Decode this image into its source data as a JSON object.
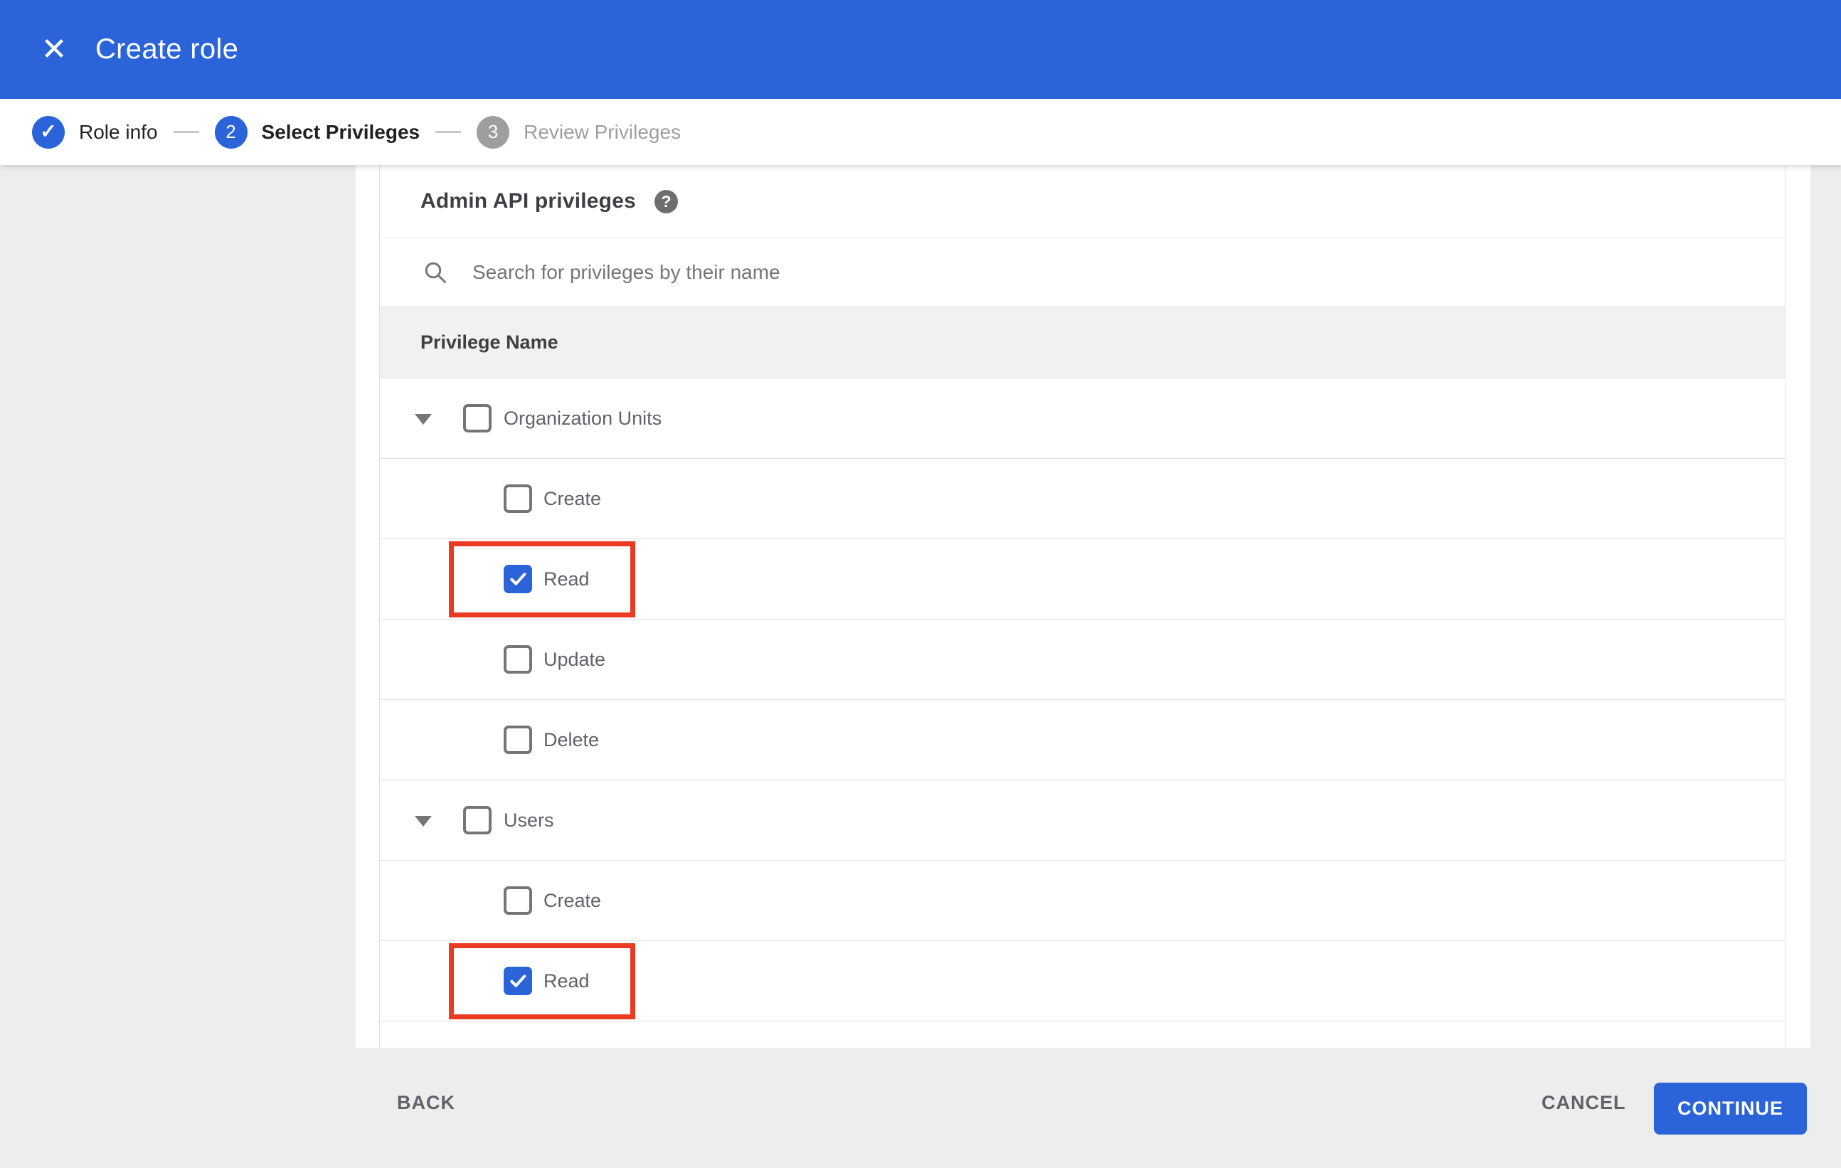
{
  "colors": {
    "accent": "#2b64d9",
    "highlight_red": "#e83b22",
    "page_gray": "#ededed",
    "step_inactive_gray": "#9e9e9e"
  },
  "icons": {
    "close": "✕",
    "check": "✓",
    "help": "?"
  },
  "titlebar": {
    "title": "Create role"
  },
  "stepper": {
    "steps": [
      {
        "label": "Role info",
        "status": "complete",
        "number": ""
      },
      {
        "label": "Select Privileges",
        "status": "current",
        "number": "2"
      },
      {
        "label": "Review Privileges",
        "status": "upcoming",
        "number": "3"
      }
    ]
  },
  "panel": {
    "heading": "Admin API privileges",
    "search": {
      "placeholder": "Search for privileges by their name",
      "value": ""
    },
    "column_header": "Privilege Name",
    "rows": [
      {
        "label": "Organization Units",
        "level": 1,
        "checked": false,
        "expanded": true,
        "highlighted": false
      },
      {
        "label": "Create",
        "level": 2,
        "checked": false,
        "highlighted": false
      },
      {
        "label": "Read",
        "level": 2,
        "checked": true,
        "highlighted": true
      },
      {
        "label": "Update",
        "level": 2,
        "checked": false,
        "highlighted": false
      },
      {
        "label": "Delete",
        "level": 2,
        "checked": false,
        "highlighted": false
      },
      {
        "label": "Users",
        "level": 1,
        "checked": false,
        "expanded": true,
        "highlighted": false
      },
      {
        "label": "Create",
        "level": 2,
        "checked": false,
        "highlighted": false
      },
      {
        "label": "Read",
        "level": 2,
        "checked": true,
        "highlighted": true
      }
    ]
  },
  "footer": {
    "back_label": "BACK",
    "cancel_label": "CANCEL",
    "continue_label": "CONTINUE"
  }
}
